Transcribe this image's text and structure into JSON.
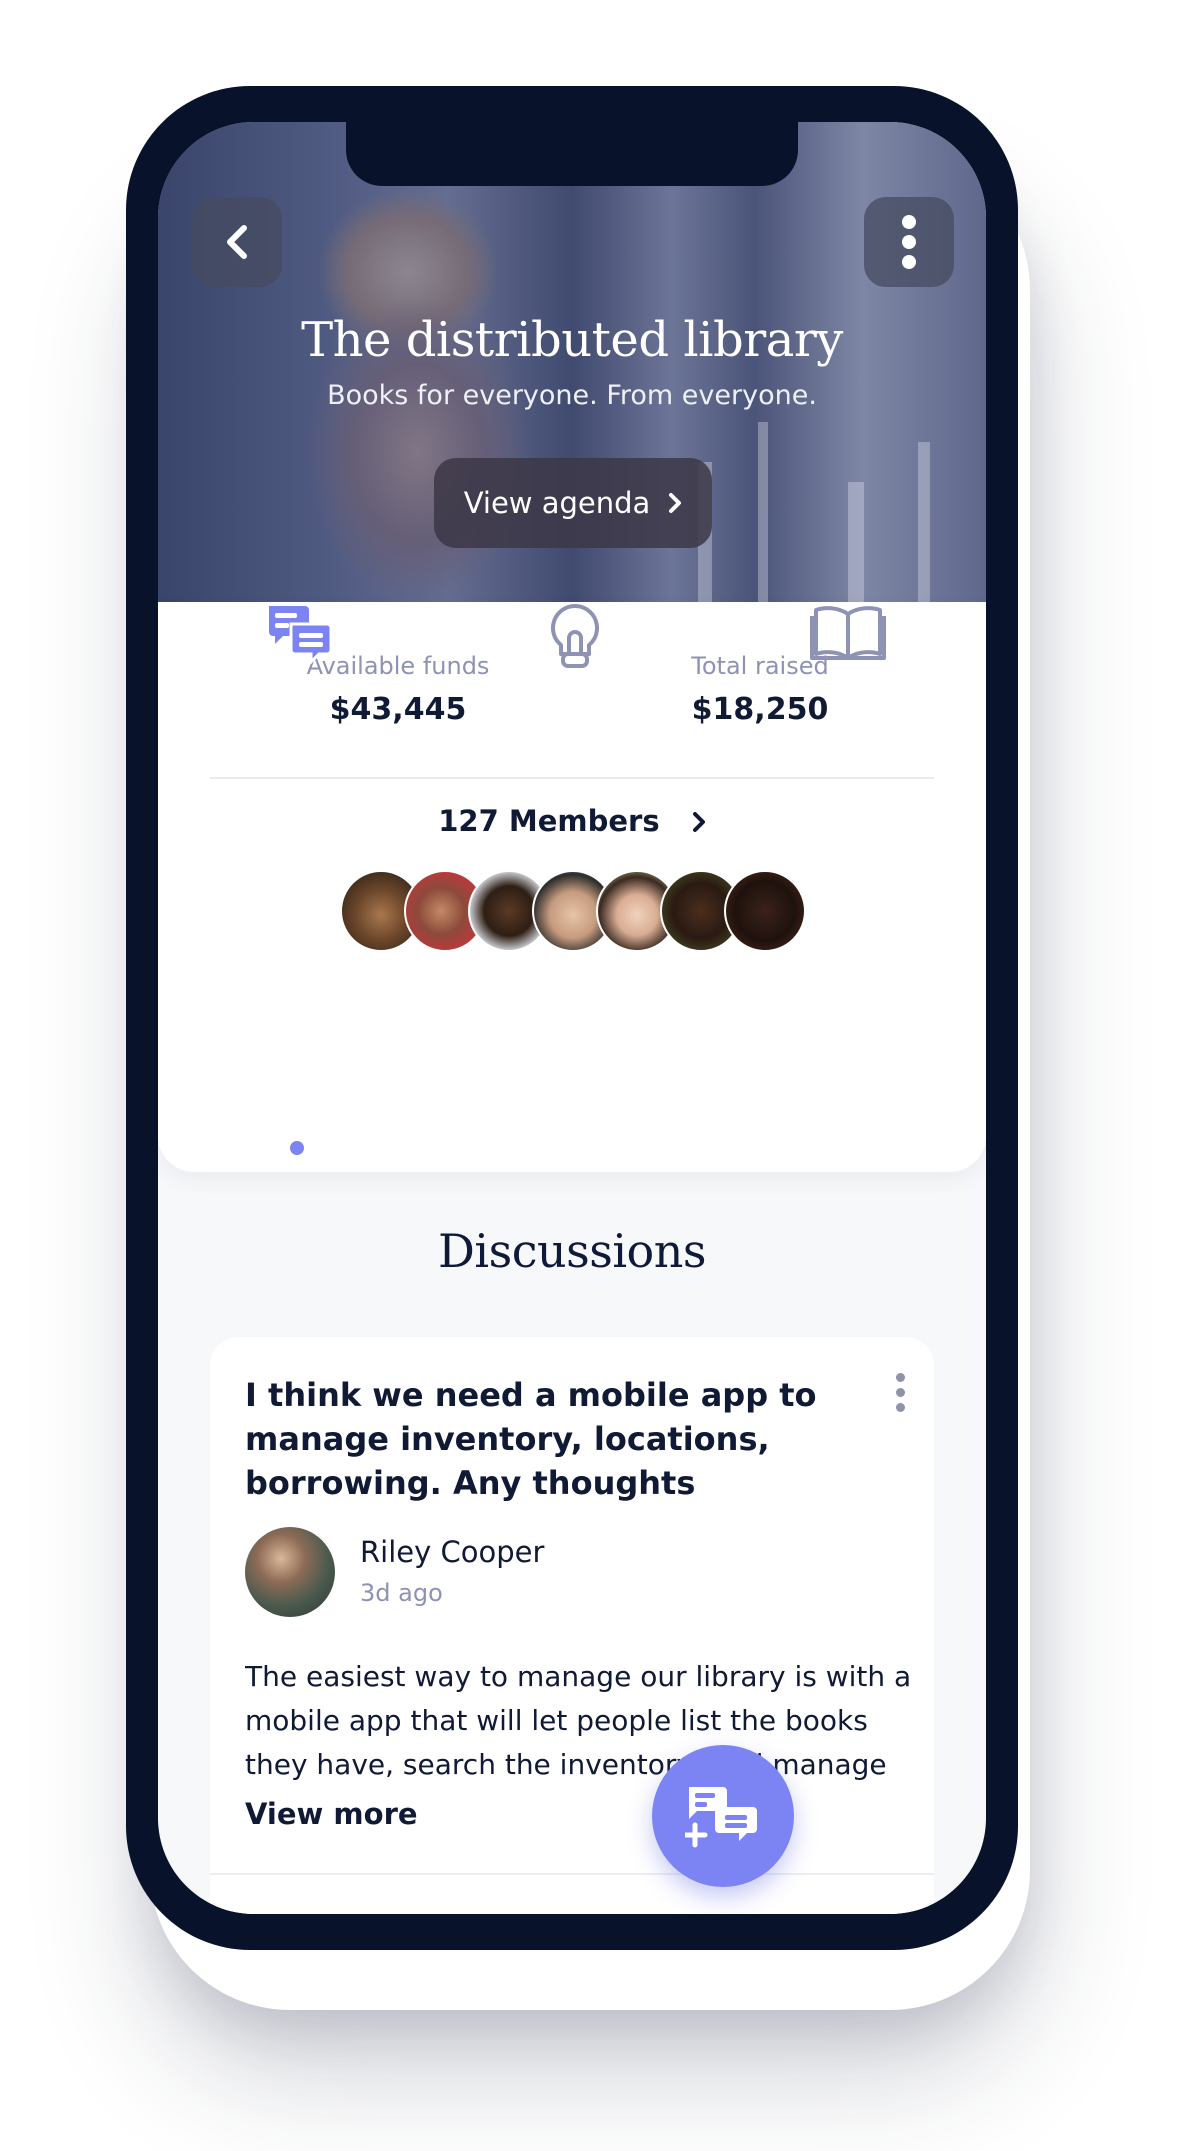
{
  "hero": {
    "title": "The distributed library",
    "subtitle": "Books for everyone. From everyone.",
    "agenda_label": "View agenda"
  },
  "stats": {
    "available_label": "Available funds",
    "available_value": "$43,445",
    "raised_label": "Total raised",
    "raised_value": "$18,250"
  },
  "members": {
    "label": "127 Members",
    "avatar_count": 7
  },
  "tabs": [
    {
      "name": "discussions",
      "icon": "chat-icon",
      "active": true
    },
    {
      "name": "ideas",
      "icon": "lightbulb-icon",
      "active": false
    },
    {
      "name": "library",
      "icon": "book-icon",
      "active": false
    }
  ],
  "discussions": {
    "title": "Discussions",
    "post": {
      "title": "I think we need a mobile app to manage inventory, locations, borrowing. Any thoughts",
      "author": "Riley Cooper",
      "time": "3d ago",
      "body": "The easiest way to manage our library is with a mobile app that will let people list the books they have, search the inventory, and manage",
      "view_more": "View more"
    }
  },
  "colors": {
    "accent": "#7c84f3",
    "dark": "#101a35",
    "muted": "#8e93b4",
    "frame": "#08132b"
  }
}
